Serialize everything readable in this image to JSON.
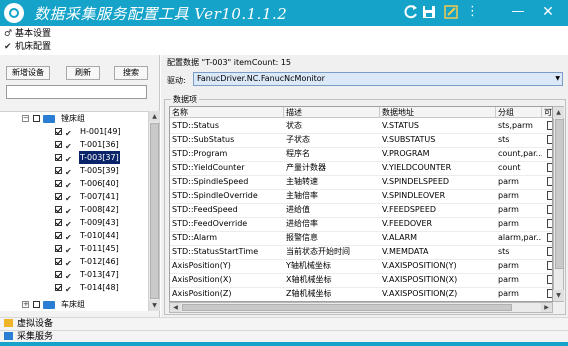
{
  "titlebar": {
    "title": "数据采集服务配置工具 Ver10.1.1.2",
    "icons": [
      "app-logo-icon",
      "refresh-icon",
      "save-icon",
      "edit-icon",
      "more-icon",
      "minimize-icon",
      "close-icon"
    ],
    "more_glyph": "⋮",
    "minimize_glyph": "—",
    "close_glyph": "✕",
    "accent": "#15a3c9"
  },
  "menu": {
    "basic_settings": "基本设置",
    "machine_config": "机床配置"
  },
  "left": {
    "add_device_button": "新增设备",
    "refresh_button": "刷新",
    "search_button": "搜索",
    "search_value": "",
    "tree": {
      "group_lathe": "镗床组",
      "devices": [
        "H-001[49]",
        "T-001[36]",
        "T-003[37]",
        "T-005[39]",
        "T-006[40]",
        "T-007[41]",
        "T-008[42]",
        "T-009[43]",
        "T-010[44]",
        "T-011[45]",
        "T-012[46]",
        "T-013[47]",
        "T-014[48]"
      ],
      "selected": "T-003[37]",
      "group_other": "车床组"
    }
  },
  "right": {
    "config_header": "配置数据 \"T-003\" itemCount: 15",
    "driver_label": "驱动:",
    "driver_value": "FanucDriver.NC.FanucNcMonitor",
    "group_label": "数据项",
    "columns": [
      "名称",
      "描述",
      "数据地址",
      "分组",
      "可写"
    ],
    "rows": [
      [
        "STD::Status",
        "状态",
        "V.STATUS",
        "sts,parm"
      ],
      [
        "STD::SubStatus",
        "子状态",
        "V.SUBSTATUS",
        "sts"
      ],
      [
        "STD::Program",
        "程序名",
        "V.PROGRAM",
        "count,par..."
      ],
      [
        "STD::YieldCounter",
        "产量计数器",
        "V.YIELDCOUNTER",
        "count"
      ],
      [
        "STD::SpindleSpeed",
        "主轴转速",
        "V.SPINDELSPEED",
        "parm"
      ],
      [
        "STD::SpindleOverride",
        "主轴倍率",
        "V.SPINDLEOVER",
        "parm"
      ],
      [
        "STD::FeedSpeed",
        "进给值",
        "V.FEEDSPEED",
        "parm"
      ],
      [
        "STD::FeedOverride",
        "进给倍率",
        "V.FEEDOVER",
        "parm"
      ],
      [
        "STD::Alarm",
        "报警信息",
        "V.ALARM",
        "alarm,par..."
      ],
      [
        "STD::StatusStartTime",
        "当前状态开始时间",
        "V.MEMDATA",
        "sts"
      ],
      [
        "AxisPosition(Y)",
        "Y轴机械坐标",
        "V.AXISPOSITION(Y)",
        "parm"
      ],
      [
        "AxisPosition(X)",
        "X轴机械坐标",
        "V.AXISPOSITION(X)",
        "parm"
      ],
      [
        "AxisPosition(Z)",
        "Z轴机械坐标",
        "V.AXISPOSITION(Z)",
        "parm"
      ]
    ]
  },
  "bottom": {
    "virtual_device": "虚拟设备",
    "collect_service": "采集服务"
  }
}
